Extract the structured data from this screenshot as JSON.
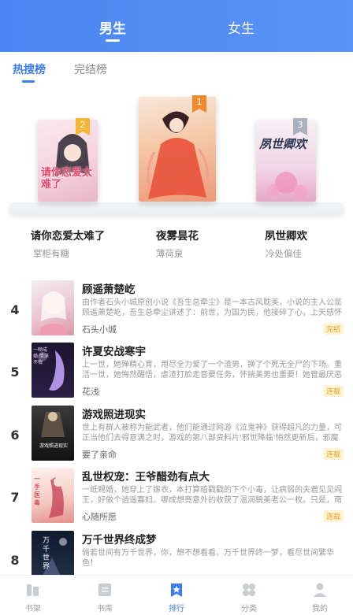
{
  "header": {
    "tabs": [
      "男生",
      "女生"
    ]
  },
  "subtabs": [
    "热搜榜",
    "完结榜"
  ],
  "podium": [
    {
      "rank": "2",
      "title": "请你恋爱太难了",
      "author": "掌柜有糖",
      "cover_text": "请你恋爱太难了"
    },
    {
      "rank": "1",
      "title": "夜雾昙花",
      "author": "薄荷泉"
    },
    {
      "rank": "3",
      "title": "夙世卿欢",
      "author": "冷处偏佳",
      "cover_text": "夙世卿欢"
    }
  ],
  "list": [
    {
      "rank": "4",
      "title": "顾遥萧楚屹",
      "desc": "由作者石头小城原创小说《吾生总牵尘》是一本古风耽美，小说的主人公是顾遥萧楚屹，吾生总牵尘讲述了：前世，为国为民，他接碎了心，上天感怀他这样",
      "author": "石头小城",
      "badge": "完结"
    },
    {
      "rank": "5",
      "title": "许夏安战寒宇",
      "desc": "上一世，她殚精心育，用尽全力爱了一个渣男，换了个死无全尸的下场。重活一世，她悔然醒悟，虐渣打脸走音要任务，怀揣美男也重要！她管最厌恶的人。",
      "author": "花浅",
      "badge": "连载",
      "cover_text": "一吻成婚 情深不悔"
    },
    {
      "rank": "6",
      "title": "游戏照进现实",
      "desc": "世上有群人被称为能武者，他们能通过网游《泣鬼神》获得超凡的力量，可正当他们去得意满之时，游戏的第八部资料片'邪世降临'悄然更新后，邪魔开始大肆入",
      "author": "要了亲命",
      "badge": "连载",
      "cover_text": "游戏照进现实"
    },
    {
      "rank": "7",
      "title": "乱世权宠：王爷醋劲有点大",
      "desc": "一纸赐婚，她穿上了嫁衣，本打算暗戳戳的下个小毒，让病弱的夫君见见阎王，好做个逍遥寡妇。哪成想竟意外的收获了温润貌美老公一枚。只是，南宫",
      "author": "心随所愿",
      "badge": "连载",
      "cover_text": "一手医毒"
    },
    {
      "rank": "8",
      "title": "万千世界终成梦",
      "desc": "倘若世间有万千世界，你，想不想看看。万千世界终一梦，看尽世间繁华色！",
      "author": "",
      "badge": "",
      "cover_text": "万千世界"
    }
  ],
  "nav": [
    {
      "label": "书架",
      "icon": "bookshelf-icon"
    },
    {
      "label": "书库",
      "icon": "library-icon"
    },
    {
      "label": "排行",
      "icon": "ranking-icon",
      "active": true
    },
    {
      "label": "分类",
      "icon": "category-icon"
    },
    {
      "label": "我的",
      "icon": "profile-icon"
    }
  ],
  "colors": {
    "accent": "#3b7cf0",
    "header_start": "#4a86f2",
    "badge_text": "#f0a020",
    "badge_bg": "#fff3d6",
    "rank1": "#f08a2c",
    "rank2": "#f4b636",
    "rank3": "#a9b1be"
  }
}
